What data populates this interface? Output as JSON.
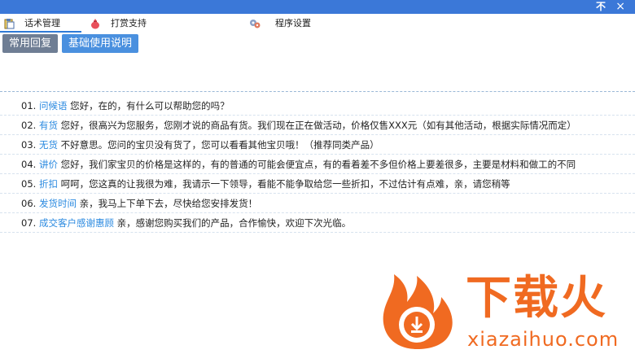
{
  "titlebar": {
    "pin_label": "不",
    "close_glyph": "×"
  },
  "tabs": [
    {
      "label": "话术管理",
      "icon": "clipboard-icon",
      "active": true
    },
    {
      "label": "打赏支持",
      "icon": "money-bag-icon",
      "active": false
    },
    {
      "label": "程序设置",
      "icon": "gears-icon",
      "active": false
    }
  ],
  "toolbar": {
    "common_reply_label": "常用回复",
    "basic_guide_label": "基础使用说明"
  },
  "replies": [
    {
      "num": "01.",
      "keyword": "问候语",
      "text": "您好，在的，有什么可以帮助您的吗？"
    },
    {
      "num": "02.",
      "keyword": "有货",
      "text": "您好，很高兴为您服务，您刚才说的商品有货。我们现在正在做活动，价格仅售XXX元（如有其他活动，根据实际情况而定）"
    },
    {
      "num": "03.",
      "keyword": "无货",
      "text": "不好意思。您问的宝贝没有货了，您可以看看其他宝贝哦！（推荐同类产品）"
    },
    {
      "num": "04.",
      "keyword": "讲价",
      "text": "您好，我们家宝贝的价格是这样的，有的普通的可能会便宜点，有的看着差不多但价格上要差很多，主要是材料和做工的不同"
    },
    {
      "num": "05.",
      "keyword": "折扣",
      "text": "呵呵，您这真的让我很为难，我请示一下领导，看能不能争取给您一些折扣，不过估计有点难，亲，请您稍等"
    },
    {
      "num": "06.",
      "keyword": "发货时间",
      "text": "亲，我马上下单下去，尽快给您安排发货！"
    },
    {
      "num": "07.",
      "keyword": "成交客户感谢惠顾",
      "text": "亲，感谢您购买我们的产品，合作愉快，欢迎下次光临。"
    }
  ],
  "watermark": {
    "brand": "下载火",
    "domain": "xiazaihuo.com"
  },
  "colors": {
    "titlebar": "#3b78d8",
    "keyword": "#2b8ae0",
    "button_gray": "#6f7e94",
    "button_blue": "#4a90df",
    "brand_orange": "#f06a21"
  }
}
